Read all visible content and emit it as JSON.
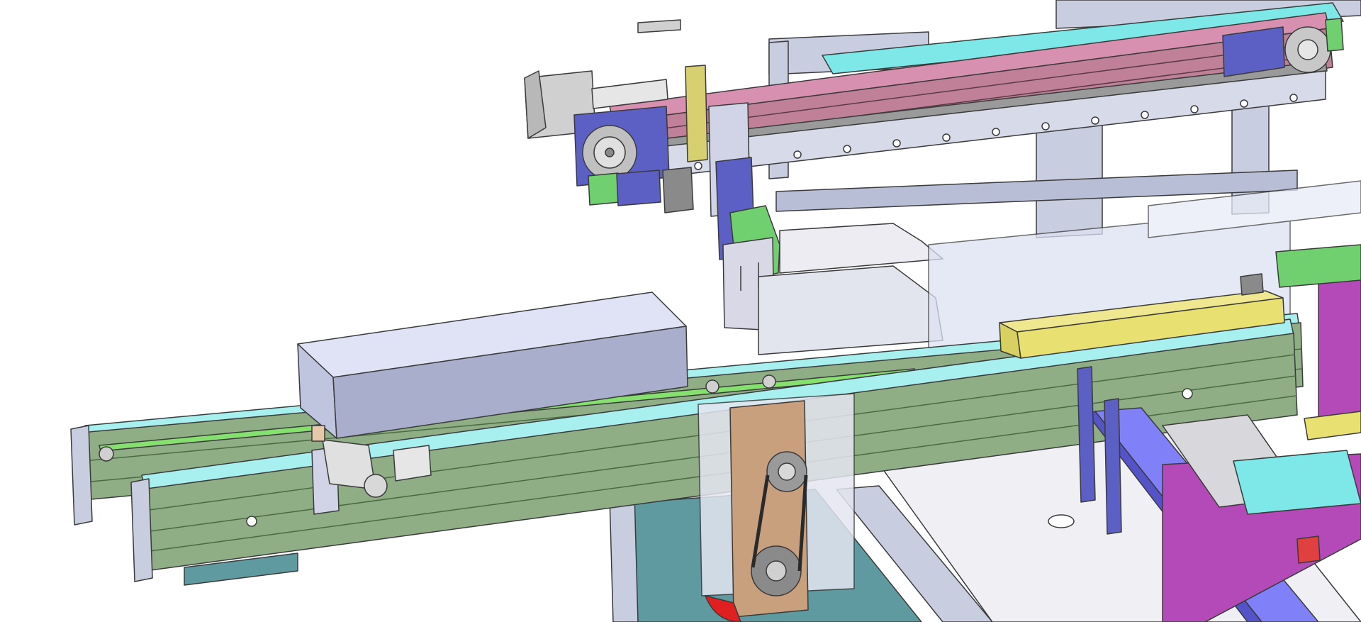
{
  "scene": {
    "kind": "cad-assembly-render",
    "subject": "belt-conveyor-transfer-station",
    "background": "#ffffff"
  },
  "colors": {
    "frame": "#c9cde0",
    "frame_dark": "#9aa0b8",
    "conveyor_green": "#8fae86",
    "conveyor_green_dark": "#6f8f68",
    "rail_cyan": "#a8f0f0",
    "belt_green": "#86e070",
    "bracket_blue": "#5c5fc4",
    "upper_rail_pink": "#c08098",
    "upper_rail_cyan": "#7ee8e8",
    "cover_box": "#c8cde6",
    "yellow_bar": "#e8e070",
    "motor_gray": "#d0d0d0",
    "motor_plate_tan": "#c9a07e",
    "floor_teal": "#5e9aa0",
    "magenta_frame": "#b34ab8",
    "blue_beam": "#6a6af0",
    "green_plate": "#70d070",
    "red_belt": "#e02020"
  },
  "components": [
    {
      "name": "lower-belt-conveyor",
      "icon": "conveyor-icon"
    },
    {
      "name": "upper-linear-module",
      "icon": "linear-rail-icon"
    },
    {
      "name": "stepper-motor",
      "icon": "motor-icon"
    },
    {
      "name": "drive-pulley",
      "icon": "pulley-icon"
    },
    {
      "name": "product-box",
      "icon": "box-icon"
    },
    {
      "name": "pneumatic-cylinder",
      "icon": "cylinder-icon"
    }
  ]
}
